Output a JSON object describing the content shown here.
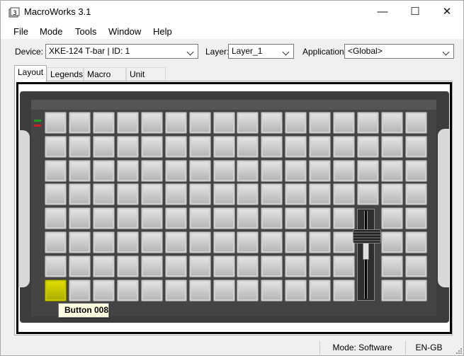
{
  "window": {
    "title": "MacroWorks 3.1",
    "controls": {
      "minimize": "—",
      "maximize": "☐",
      "close": "✕"
    }
  },
  "menu": [
    "File",
    "Mode",
    "Tools",
    "Window",
    "Help"
  ],
  "toolbar": {
    "device_label": "Device:",
    "device_value": "XKE-124 T-bar | ID: 1",
    "layer_label": "Layer:",
    "layer_value": "Layer_1",
    "application_label": "Application:",
    "application_value": "<Global>"
  },
  "tabs": [
    "Layout",
    "Legends",
    "Macro List",
    "Unit Data"
  ],
  "active_tab": "Layout",
  "device": {
    "rows": 8,
    "cols": 16,
    "selected_button": "Button 008",
    "tbar_present": true,
    "colors": {
      "body": "#3c3c3c",
      "key": "#c8c8c8",
      "selected_key": "#d4d400"
    }
  },
  "tooltip": "Button 008",
  "status": {
    "mode": "Mode: Software",
    "locale": "EN-GB"
  }
}
